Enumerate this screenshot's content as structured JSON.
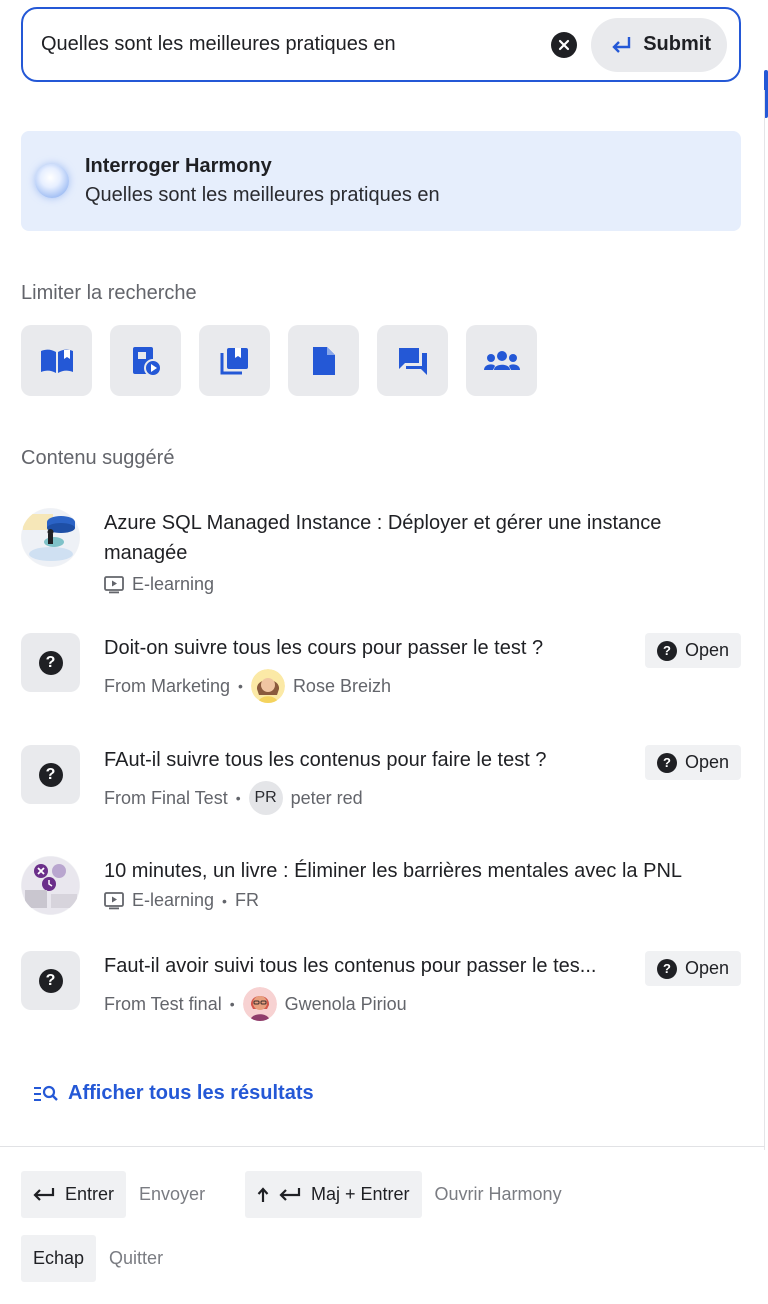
{
  "search": {
    "query": "Quelles sont les meilleures pratiques en",
    "submit_label": "Submit",
    "clear_icon": "close-circle-icon",
    "submit_icon": "enter-arrow-icon"
  },
  "harmony": {
    "title": "Interroger Harmony",
    "query": "Quelles sont les meilleures pratiques en"
  },
  "filters": {
    "title": "Limiter la recherche",
    "icons": [
      "book-open-icon",
      "video-document-icon",
      "library-icon",
      "document-icon",
      "forum-icon",
      "group-icon"
    ]
  },
  "suggested": {
    "title": "Contenu suggéré",
    "items": [
      {
        "title": "Azure SQL Managed Instance : Déployer et gérer une instance managée",
        "type": "E-learning",
        "lang": ""
      },
      {
        "title": "Doit-on suivre tous les cours  pour passer le test ?",
        "source": "From Marketing",
        "author": "Rose Breizh",
        "badge": "Open"
      },
      {
        "title": "FAut-il suivre tous les contenus pour faire le test ?",
        "source": "From Final Test",
        "author": "peter red",
        "author_initials": "PR",
        "badge": "Open"
      },
      {
        "title": "10 minutes, un livre : Éliminer les barrières mentales avec la PNL",
        "type": "E-learning",
        "lang": "FR"
      },
      {
        "title": "Faut-il avoir suivi tous les contenus pour passer le tes...",
        "source": "From Test final",
        "author": "Gwenola Piriou",
        "badge": "Open"
      }
    ]
  },
  "see_all": "Afficher tous les résultats",
  "shortcuts": {
    "enter_key": "Entrer",
    "enter_desc": "Envoyer",
    "shift_enter_key": "Maj + Entrer",
    "shift_enter_desc": "Ouvrir Harmony",
    "esc_key": "Echap",
    "esc_desc": "Quitter"
  },
  "colors": {
    "accent": "#2458d6",
    "harmony_bg": "#e6eefc",
    "button_bg": "#e9eaed"
  }
}
